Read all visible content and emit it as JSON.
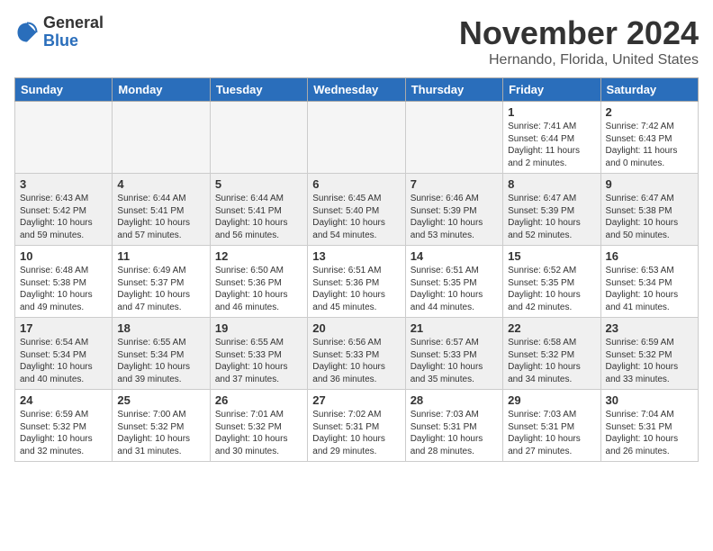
{
  "header": {
    "logo": {
      "general": "General",
      "blue": "Blue"
    },
    "month": "November 2024",
    "location": "Hernando, Florida, United States"
  },
  "weekdays": [
    "Sunday",
    "Monday",
    "Tuesday",
    "Wednesday",
    "Thursday",
    "Friday",
    "Saturday"
  ],
  "weeks": [
    [
      {
        "day": "",
        "info": ""
      },
      {
        "day": "",
        "info": ""
      },
      {
        "day": "",
        "info": ""
      },
      {
        "day": "",
        "info": ""
      },
      {
        "day": "",
        "info": ""
      },
      {
        "day": "1",
        "info": "Sunrise: 7:41 AM\nSunset: 6:44 PM\nDaylight: 11 hours\nand 2 minutes."
      },
      {
        "day": "2",
        "info": "Sunrise: 7:42 AM\nSunset: 6:43 PM\nDaylight: 11 hours\nand 0 minutes."
      }
    ],
    [
      {
        "day": "3",
        "info": "Sunrise: 6:43 AM\nSunset: 5:42 PM\nDaylight: 10 hours\nand 59 minutes."
      },
      {
        "day": "4",
        "info": "Sunrise: 6:44 AM\nSunset: 5:41 PM\nDaylight: 10 hours\nand 57 minutes."
      },
      {
        "day": "5",
        "info": "Sunrise: 6:44 AM\nSunset: 5:41 PM\nDaylight: 10 hours\nand 56 minutes."
      },
      {
        "day": "6",
        "info": "Sunrise: 6:45 AM\nSunset: 5:40 PM\nDaylight: 10 hours\nand 54 minutes."
      },
      {
        "day": "7",
        "info": "Sunrise: 6:46 AM\nSunset: 5:39 PM\nDaylight: 10 hours\nand 53 minutes."
      },
      {
        "day": "8",
        "info": "Sunrise: 6:47 AM\nSunset: 5:39 PM\nDaylight: 10 hours\nand 52 minutes."
      },
      {
        "day": "9",
        "info": "Sunrise: 6:47 AM\nSunset: 5:38 PM\nDaylight: 10 hours\nand 50 minutes."
      }
    ],
    [
      {
        "day": "10",
        "info": "Sunrise: 6:48 AM\nSunset: 5:38 PM\nDaylight: 10 hours\nand 49 minutes."
      },
      {
        "day": "11",
        "info": "Sunrise: 6:49 AM\nSunset: 5:37 PM\nDaylight: 10 hours\nand 47 minutes."
      },
      {
        "day": "12",
        "info": "Sunrise: 6:50 AM\nSunset: 5:36 PM\nDaylight: 10 hours\nand 46 minutes."
      },
      {
        "day": "13",
        "info": "Sunrise: 6:51 AM\nSunset: 5:36 PM\nDaylight: 10 hours\nand 45 minutes."
      },
      {
        "day": "14",
        "info": "Sunrise: 6:51 AM\nSunset: 5:35 PM\nDaylight: 10 hours\nand 44 minutes."
      },
      {
        "day": "15",
        "info": "Sunrise: 6:52 AM\nSunset: 5:35 PM\nDaylight: 10 hours\nand 42 minutes."
      },
      {
        "day": "16",
        "info": "Sunrise: 6:53 AM\nSunset: 5:34 PM\nDaylight: 10 hours\nand 41 minutes."
      }
    ],
    [
      {
        "day": "17",
        "info": "Sunrise: 6:54 AM\nSunset: 5:34 PM\nDaylight: 10 hours\nand 40 minutes."
      },
      {
        "day": "18",
        "info": "Sunrise: 6:55 AM\nSunset: 5:34 PM\nDaylight: 10 hours\nand 39 minutes."
      },
      {
        "day": "19",
        "info": "Sunrise: 6:55 AM\nSunset: 5:33 PM\nDaylight: 10 hours\nand 37 minutes."
      },
      {
        "day": "20",
        "info": "Sunrise: 6:56 AM\nSunset: 5:33 PM\nDaylight: 10 hours\nand 36 minutes."
      },
      {
        "day": "21",
        "info": "Sunrise: 6:57 AM\nSunset: 5:33 PM\nDaylight: 10 hours\nand 35 minutes."
      },
      {
        "day": "22",
        "info": "Sunrise: 6:58 AM\nSunset: 5:32 PM\nDaylight: 10 hours\nand 34 minutes."
      },
      {
        "day": "23",
        "info": "Sunrise: 6:59 AM\nSunset: 5:32 PM\nDaylight: 10 hours\nand 33 minutes."
      }
    ],
    [
      {
        "day": "24",
        "info": "Sunrise: 6:59 AM\nSunset: 5:32 PM\nDaylight: 10 hours\nand 32 minutes."
      },
      {
        "day": "25",
        "info": "Sunrise: 7:00 AM\nSunset: 5:32 PM\nDaylight: 10 hours\nand 31 minutes."
      },
      {
        "day": "26",
        "info": "Sunrise: 7:01 AM\nSunset: 5:32 PM\nDaylight: 10 hours\nand 30 minutes."
      },
      {
        "day": "27",
        "info": "Sunrise: 7:02 AM\nSunset: 5:31 PM\nDaylight: 10 hours\nand 29 minutes."
      },
      {
        "day": "28",
        "info": "Sunrise: 7:03 AM\nSunset: 5:31 PM\nDaylight: 10 hours\nand 28 minutes."
      },
      {
        "day": "29",
        "info": "Sunrise: 7:03 AM\nSunset: 5:31 PM\nDaylight: 10 hours\nand 27 minutes."
      },
      {
        "day": "30",
        "info": "Sunrise: 7:04 AM\nSunset: 5:31 PM\nDaylight: 10 hours\nand 26 minutes."
      }
    ]
  ]
}
